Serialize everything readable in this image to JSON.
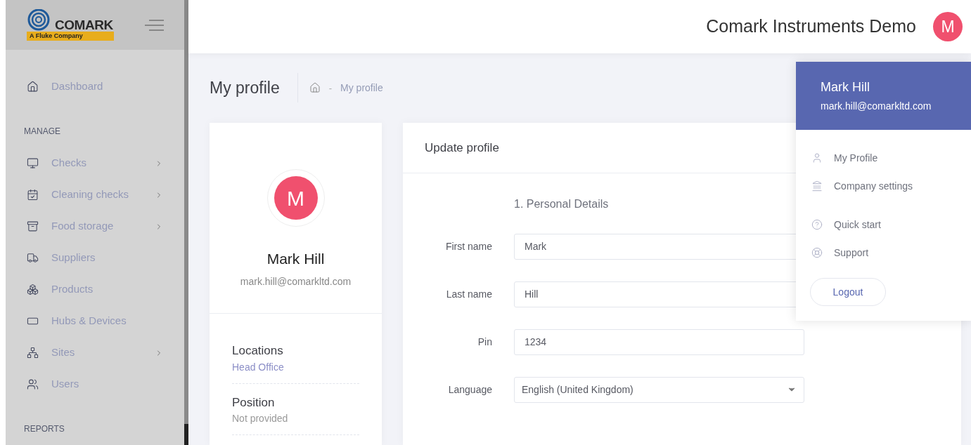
{
  "brand": {
    "name": "COMARK",
    "tagline": "A Fluke Company"
  },
  "sidebar": {
    "items": [
      {
        "kind": "item",
        "label": "Dashboard",
        "has_children": false
      },
      {
        "kind": "section",
        "label": "MANAGE"
      },
      {
        "kind": "item",
        "label": "Checks",
        "has_children": true
      },
      {
        "kind": "item",
        "label": "Cleaning checks",
        "has_children": true
      },
      {
        "kind": "item",
        "label": "Food storage",
        "has_children": true
      },
      {
        "kind": "item",
        "label": "Suppliers",
        "has_children": false
      },
      {
        "kind": "item",
        "label": "Products",
        "has_children": false
      },
      {
        "kind": "item",
        "label": "Hubs & Devices",
        "has_children": false
      },
      {
        "kind": "item",
        "label": "Sites",
        "has_children": true
      },
      {
        "kind": "item",
        "label": "Users",
        "has_children": false
      },
      {
        "kind": "section",
        "label": "REPORTS"
      }
    ]
  },
  "header": {
    "company": "Comark Instruments Demo",
    "avatar": "M"
  },
  "page": {
    "title": "My profile",
    "separator": "-",
    "breadcrumb": "My profile"
  },
  "profile_card": {
    "avatar": "M",
    "name": "Mark Hill",
    "email": "mark.hill@comarkltd.com",
    "details": [
      {
        "label": "Locations",
        "value": "Head Office",
        "kind": "link"
      },
      {
        "label": "Position",
        "value": "Not provided",
        "kind": "plain"
      }
    ]
  },
  "update_profile": {
    "title": "Update profile",
    "section": "1. Personal Details",
    "fields": [
      {
        "label": "First name",
        "value": "Mark",
        "kind": "text"
      },
      {
        "label": "Last name",
        "value": "Hill",
        "kind": "text"
      },
      {
        "label": "Pin",
        "value": "1234",
        "kind": "text"
      },
      {
        "label": "Language",
        "value": "English (United Kingdom)",
        "kind": "select"
      }
    ]
  },
  "user_menu": {
    "name": "Mark Hill",
    "email": "mark.hill@comarkltd.com",
    "items": [
      {
        "label": "My Profile"
      },
      {
        "label": "Company settings"
      },
      {
        "label": "Quick start"
      },
      {
        "label": "Support"
      }
    ],
    "logout": "Logout"
  }
}
